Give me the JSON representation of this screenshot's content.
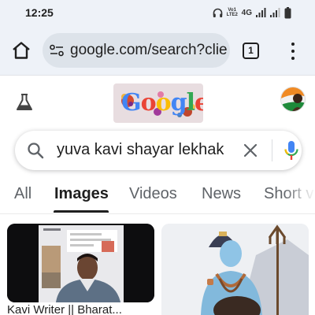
{
  "status_bar": {
    "time": "12:25",
    "volte_label": "Vo1\nLTE2",
    "network": "4G",
    "icons": [
      "headset-icon",
      "signal-icon",
      "signal-icon",
      "battery-icon"
    ]
  },
  "browser": {
    "url": "google.com/search?clie",
    "tab_count": "1",
    "icons": [
      "home-icon",
      "site-settings-icon",
      "tab-switcher-icon",
      "more-menu-icon"
    ]
  },
  "google": {
    "doodle_text": "Google",
    "icons": [
      "labs-flask-icon",
      "account-avatar"
    ]
  },
  "search": {
    "query": "yuva kavi shayar lekhak",
    "icons": [
      "search-icon",
      "clear-icon",
      "mic-icon"
    ]
  },
  "tabs": [
    {
      "label": "All",
      "active": false
    },
    {
      "label": "Images",
      "active": true
    },
    {
      "label": "Videos",
      "active": false
    },
    {
      "label": "News",
      "active": false
    },
    {
      "label": "Short v",
      "active": false
    }
  ],
  "results": [
    {
      "title": "Kavi Writer || Bharat..."
    },
    {
      "title": ""
    }
  ],
  "colors": {
    "chrome_bg": "#eef2f8",
    "url_bar_bg": "#dde3ea",
    "google_blue": "#4285f4",
    "google_red": "#ea4335",
    "google_yellow": "#fbbc04",
    "google_green": "#34a853"
  }
}
